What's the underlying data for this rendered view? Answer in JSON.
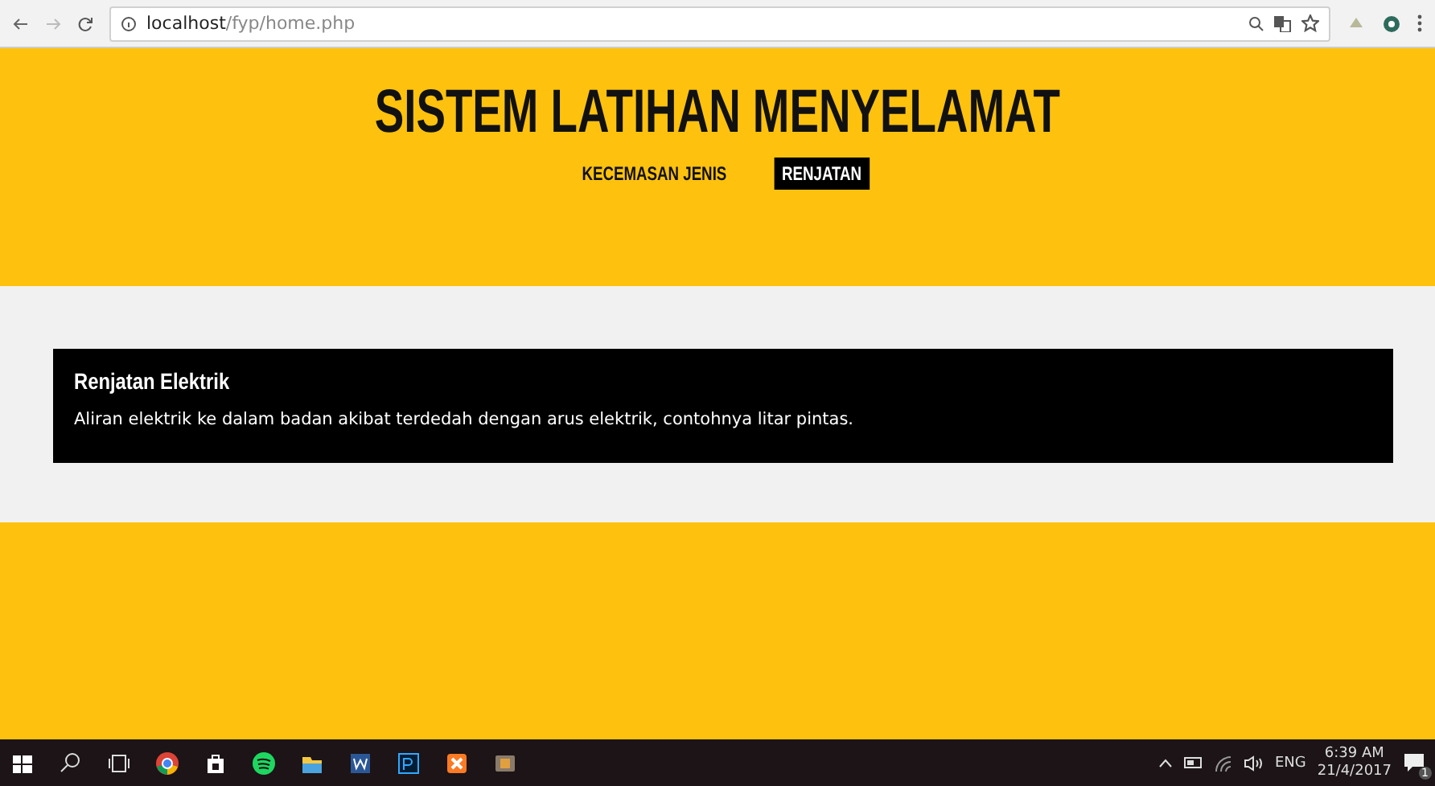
{
  "browser": {
    "url_host": "localhost",
    "url_path": "/fyp/home.php"
  },
  "header": {
    "title": "SISTEM LATIHAN MENYELAMAT",
    "nav": [
      {
        "label": "KECEMASAN JENIS",
        "selected": false
      },
      {
        "label": "RENJATAN",
        "selected": true
      }
    ]
  },
  "card": {
    "title": "Renjatan Elektrik",
    "text": "Aliran elektrik ke dalam badan akibat terdedah dengan arus elektrik, contohnya litar pintas."
  },
  "taskbar": {
    "language": "ENG",
    "time": "6:39 AM",
    "date": "21/4/2017",
    "notification_count": "1"
  }
}
